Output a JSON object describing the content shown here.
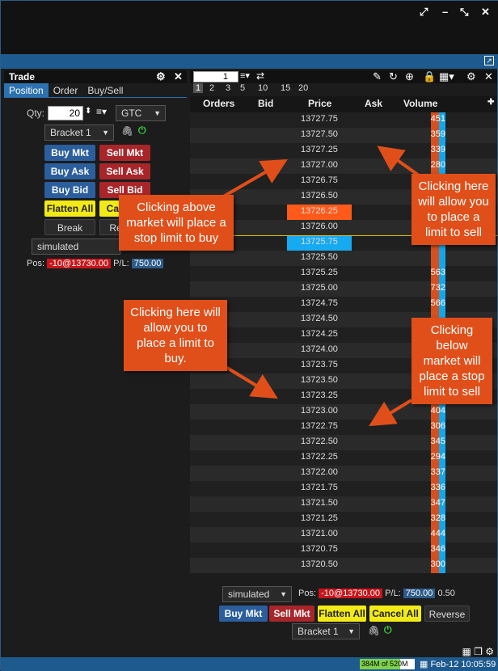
{
  "window": {
    "controls": [
      "⤢",
      "–",
      "⤡",
      "✕"
    ]
  },
  "trade_panel": {
    "title": "Trade",
    "tabs": [
      "Position",
      "Order",
      "Buy/Sell"
    ],
    "qty_label": "Qty:",
    "qty_value": "20",
    "tif": "GTC",
    "bracket": "Bracket 1",
    "buttons": {
      "buy_mkt": "Buy Mkt",
      "sell_mkt": "Sell Mkt",
      "buy_ask": "Buy Ask",
      "sell_ask": "Sell Ask",
      "buy_bid": "Buy Bid",
      "sell_bid": "Sell Bid",
      "flatten_all": "Flatten All",
      "cancel": "Can",
      "break_even": "Break Even",
      "reverse": "Re"
    },
    "account": "simulated",
    "pos_label": "Pos:",
    "pos_value": "-10@13730.00",
    "pl_label": "P/L:",
    "pl_value": "750.00"
  },
  "ladder": {
    "spin_value": "1",
    "intervals": [
      "1",
      "2",
      "3",
      "5",
      "10",
      "15",
      "20"
    ],
    "headers": {
      "orders": "Orders",
      "bid": "Bid",
      "price": "Price",
      "ask": "Ask",
      "volume": "Volume"
    },
    "rows": [
      {
        "price": "13727.75",
        "vol": "451"
      },
      {
        "price": "13727.50",
        "vol": "359"
      },
      {
        "price": "13727.25",
        "vol": "339"
      },
      {
        "price": "13727.00",
        "vol": "280"
      },
      {
        "price": "13726.75",
        "vol": ""
      },
      {
        "price": "13726.50",
        "vol": ""
      },
      {
        "price": "13726.25",
        "vol": ""
      },
      {
        "price": "13726.00",
        "vol": ""
      },
      {
        "price": "13725.75",
        "vol": ""
      },
      {
        "price": "13725.50",
        "vol": ""
      },
      {
        "price": "13725.25",
        "vol": "563"
      },
      {
        "price": "13725.00",
        "vol": "732"
      },
      {
        "price": "13724.75",
        "vol": "566"
      },
      {
        "price": "13724.50",
        "vol": ""
      },
      {
        "price": "13724.25",
        "vol": ""
      },
      {
        "price": "13724.00",
        "vol": ""
      },
      {
        "price": "13723.75",
        "vol": ""
      },
      {
        "price": "13723.50",
        "vol": ""
      },
      {
        "price": "13723.25",
        "vol": ""
      },
      {
        "price": "13723.00",
        "vol": "404"
      },
      {
        "price": "13722.75",
        "vol": "306"
      },
      {
        "price": "13722.50",
        "vol": "345"
      },
      {
        "price": "13722.25",
        "vol": "294"
      },
      {
        "price": "13722.00",
        "vol": "337"
      },
      {
        "price": "13721.75",
        "vol": "336"
      },
      {
        "price": "13721.50",
        "vol": "347"
      },
      {
        "price": "13721.25",
        "vol": "328"
      },
      {
        "price": "13721.00",
        "vol": "444"
      },
      {
        "price": "13720.75",
        "vol": "346"
      },
      {
        "price": "13720.50",
        "vol": "300"
      }
    ],
    "ask_highlight_price": "13726.25",
    "bid_highlight_price": "13725.75",
    "bottom": {
      "account": "simulated",
      "pos_label": "Pos:",
      "pos_value": "-10@13730.00",
      "pl_label": "P/L:",
      "pl_value": "750.00",
      "extra_value": "0.50",
      "buy_mkt": "Buy Mkt",
      "sell_mkt": "Sell Mkt",
      "flatten_all": "Flatten All",
      "cancel_all": "Cancel All",
      "reverse": "Reverse",
      "bracket": "Bracket 1"
    }
  },
  "callouts": {
    "above_market": "Clicking above market will place a stop limit to buy",
    "limit_sell": "Clicking here will allow you to place a limit to sell",
    "limit_buy": "Clicking here will allow you to place a limit to buy.",
    "below_market": "Clicking below market will place a stop limit to sell"
  },
  "status_bar": {
    "memory": "384M of 520M",
    "memory_fraction": 0.74,
    "clock": "Feb-12 10:05:59"
  },
  "colors": {
    "accent": "#1e5a8e",
    "callout": "#e04f1a",
    "ask": "#ff5a1a",
    "bid": "#16aaf0",
    "buy": "#2b5e9c",
    "sell": "#a8262a",
    "flatten": "#f2ea16"
  }
}
